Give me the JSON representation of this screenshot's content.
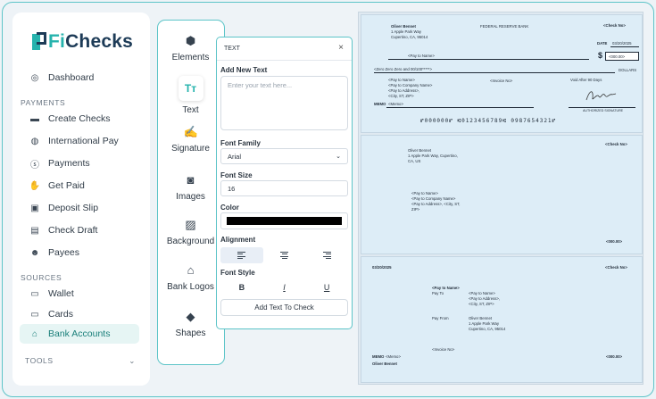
{
  "brand": {
    "name_prefix": "Fi",
    "name_suffix": "Checks"
  },
  "sidebar": {
    "top_items": [
      {
        "label": "Dashboard",
        "icon": "dashboard-icon"
      }
    ],
    "payments_label": "PAYMENTS",
    "payments_items": [
      {
        "label": "Create Checks",
        "icon": "check-icon"
      },
      {
        "label": "International Pay",
        "icon": "globe-icon"
      },
      {
        "label": "Payments",
        "icon": "dollar-icon"
      },
      {
        "label": "Get Paid",
        "icon": "hand-coin-icon"
      },
      {
        "label": "Deposit Slip",
        "icon": "deposit-icon"
      },
      {
        "label": "Check Draft",
        "icon": "draft-icon"
      },
      {
        "label": "Payees",
        "icon": "people-icon"
      }
    ],
    "sources_label": "SOURCES",
    "sources_items": [
      {
        "label": "Wallet",
        "icon": "wallet-icon"
      },
      {
        "label": "Cards",
        "icon": "card-icon"
      },
      {
        "label": "Bank Accounts",
        "icon": "bank-icon",
        "active": true
      }
    ],
    "tools_label": "TOOLS",
    "tools_chevron": "⌄"
  },
  "tools": [
    {
      "label": "Elements",
      "icon": "elements-icon"
    },
    {
      "label": "Text",
      "icon": "text-icon",
      "glyph": "Tт",
      "active": true
    },
    {
      "label": "Signature",
      "icon": "signature-icon"
    },
    {
      "label": "Images",
      "icon": "camera-icon"
    },
    {
      "label": "Background",
      "icon": "image-icon"
    },
    {
      "label": "Bank Logos",
      "icon": "bank-icon"
    },
    {
      "label": "Shapes",
      "icon": "shapes-icon"
    }
  ],
  "text_panel": {
    "title": "TEXT",
    "close": "×",
    "add_label": "Add New Text",
    "placeholder": "Enter your text here...",
    "font_family_label": "Font Family",
    "font_family_value": "Arial",
    "font_size_label": "Font Size",
    "font_size_value": "16",
    "color_label": "Color",
    "color_value": "#000000",
    "alignment_label": "Alignment",
    "font_style_label": "Font Style",
    "style_bold": "B",
    "style_italic": "I",
    "style_underline": "U",
    "add_button": "Add Text To Check"
  },
  "check1": {
    "payer_name": "Oliver Bennet",
    "payer_addr1": "1 Apple Park Way",
    "payer_addr2": "Cupertino, CA, 95014",
    "bank": "FEDERAL RESERVE BANK",
    "check_no": "<Check No>",
    "date_label": "DATE",
    "date": "03/20/2025",
    "pay_to": "<Pay to Name>",
    "dollar_sign": "$",
    "amount": "<000.00>",
    "amount_words": "<Zero Zero Zero and 00/100*****>",
    "dollars": "DOLLARS",
    "payee_lines": [
      "<Pay to Name>",
      "<Pay to Company Name>",
      "<Pay to Address>,",
      "<City, ST, ZIP>"
    ],
    "invoice": "<Invoice No>",
    "void": "Void After 90 Days",
    "memo_label": "MEMO",
    "memo": "<Memo>",
    "signature_label": "AUTHORIZED SIGNATURE",
    "micr": "⑈000000⑈ ⑆0123456789⑆ 0987654321⑈"
  },
  "check2": {
    "payer_name": "Oliver Bennet",
    "payer_addr": "1 Apple Park Way, Cupertino,",
    "payer_addr2": "CA, US",
    "check_no": "<Check No>",
    "payee_lines": [
      "<Pay to Name>",
      "<Pay to Company Name>",
      "<Pay to Address>, <City, ST,",
      "ZIP>"
    ],
    "amount": "<000.00>"
  },
  "check3": {
    "date": "03/20/2025",
    "check_no": "<Check No>",
    "pay_to": "<Pay to Name>",
    "pay_to_label": "Pay To",
    "payee_lines": [
      "<Pay to Name>",
      "<Pay to Address>,",
      "<City, ST, ZIP>"
    ],
    "pay_from_label": "Pay From",
    "from_lines": [
      "Oliver Bennet",
      "1 Apple Park Way",
      "Cupertino, CA, 95014"
    ],
    "invoice": "<Invoice No>",
    "memo_label": "MEMO",
    "memo": "<Memo>",
    "payer_name": "Oliver Bennet",
    "amount": "<000.00>"
  },
  "colors": {
    "accent": "#26b3ad",
    "brand_dark": "#1d3b57",
    "check_bg": "#ddedf7"
  }
}
